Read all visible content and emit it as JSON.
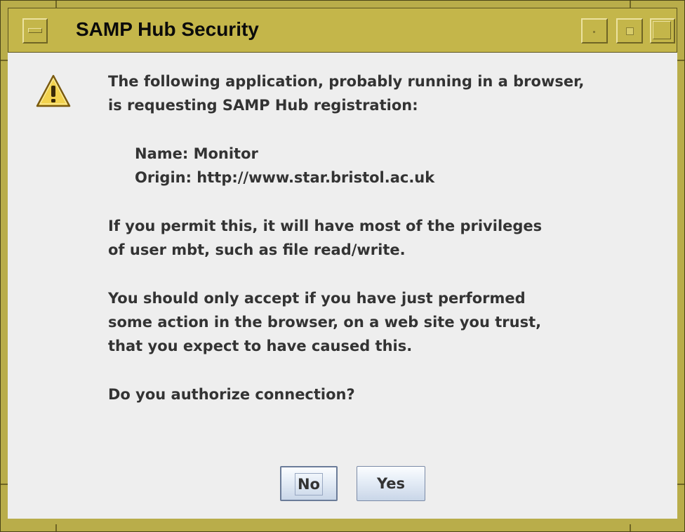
{
  "window": {
    "title": "SAMP Hub Security"
  },
  "dialog": {
    "icon": "warning-icon",
    "intro_line_1": "The following application, probably running in a browser,",
    "intro_line_2": "is requesting SAMP Hub registration:",
    "name_line": "Name: Monitor",
    "origin_line": "Origin: http://www.star.bristol.ac.uk",
    "privilege_line_1": "If you permit this, it will have most of the privileges",
    "privilege_line_2": "of user mbt, such as file read/write.",
    "advice_line_1": "You should only accept if you have just performed",
    "advice_line_2": "some action in the browser, on a web site you trust,",
    "advice_line_3": "that you expect to have caused this.",
    "question": "Do you authorize connection?"
  },
  "buttons": {
    "no_label": "No",
    "yes_label": "Yes"
  },
  "colors": {
    "titlebar": "#c4b64a",
    "frame": "#b9ad4a",
    "content_background": "#eeeeee",
    "text": "#333333",
    "warning_fill": "#f2d24e"
  }
}
